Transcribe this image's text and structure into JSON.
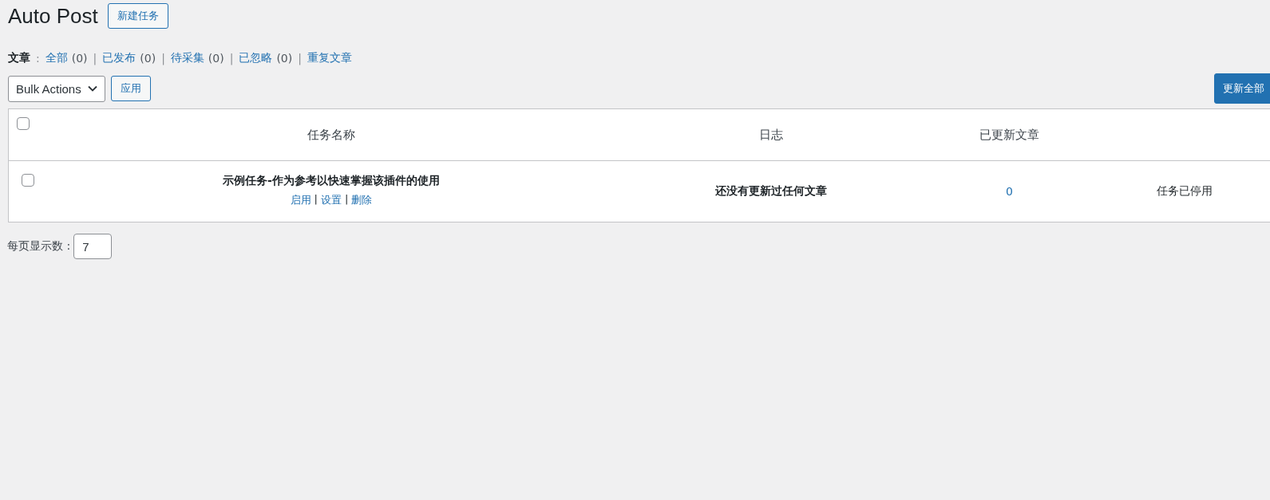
{
  "title": "Auto Post",
  "new_button": "新建任务",
  "filter": {
    "label": "文章",
    "separator": ":",
    "items": [
      {
        "label": "全部",
        "count": "(0)"
      },
      {
        "divider": "|",
        "label": "已发布",
        "count": "(0)"
      },
      {
        "divider": "|",
        "label": "待采集",
        "count": "(0)"
      },
      {
        "divider": "|",
        "label": "已忽略",
        "count": "(0)"
      },
      {
        "divider": "|",
        "label": "重复文章"
      }
    ]
  },
  "bulk_actions": "Bulk Actions",
  "apply_button": "应用",
  "update_all_button": "更新全部",
  "table": {
    "select_all_checked": false,
    "columns": [
      "任务名称",
      "日志",
      "已更新文章"
    ],
    "rows": [
      {
        "checked": false,
        "name": "示例任务-作为参考以快速掌握该插件的使用",
        "actions": [
          {
            "label": "启用"
          },
          {
            "divider": "|",
            "label": "设置"
          },
          {
            "divider": "|",
            "label": "删除"
          }
        ],
        "log": "还没有更新过任何文章",
        "updated": "0",
        "status": "任务已停用"
      }
    ]
  },
  "per_page": {
    "label": "每页显示数 :",
    "value": "7"
  }
}
